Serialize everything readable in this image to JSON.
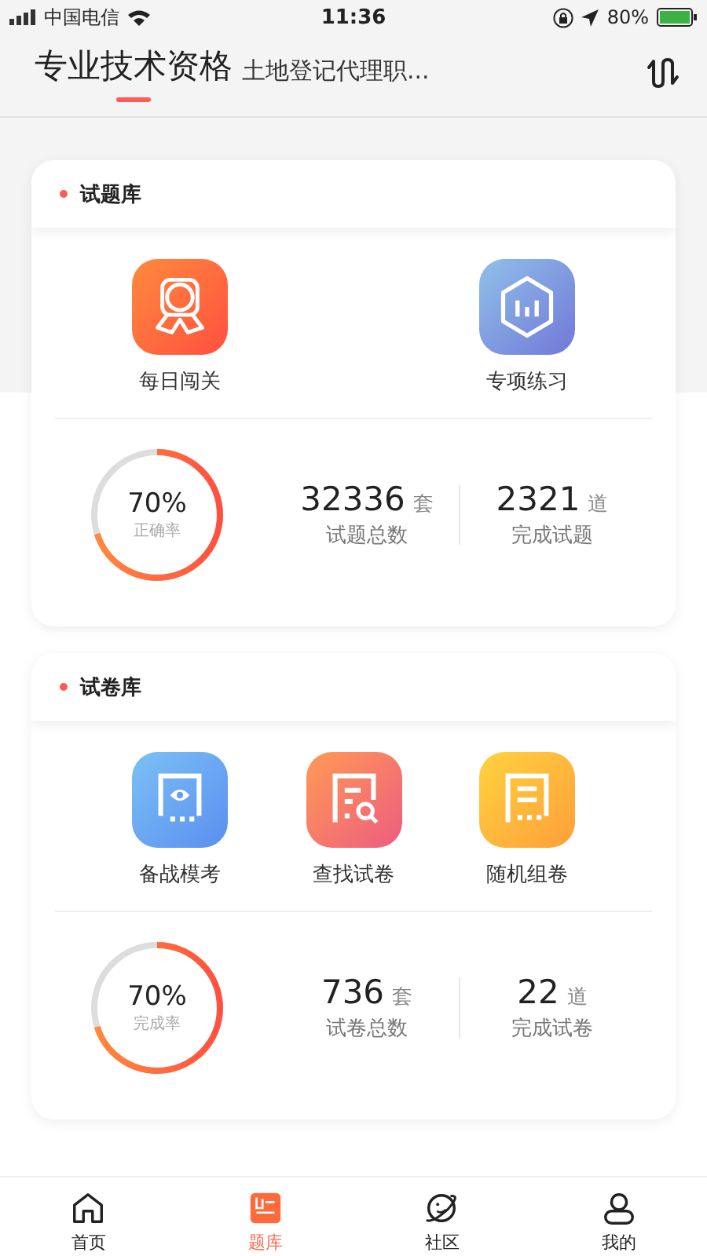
{
  "status_bar": {
    "carrier": "中国电信",
    "time": "11:36",
    "battery": "80%"
  },
  "header": {
    "tabs": [
      {
        "label": "专业技术资格",
        "selected": true
      },
      {
        "label": "土地登记代理职...",
        "selected": false
      }
    ]
  },
  "sections": [
    {
      "title": "试题库",
      "features": [
        {
          "label": "每日闯关",
          "kind": "medal"
        },
        {
          "label": "专项练习",
          "kind": "hexchart"
        }
      ],
      "ring": {
        "level": 0.7,
        "value": "70%",
        "caption": "正确率"
      },
      "stats": [
        {
          "number": "32336",
          "unit": "套",
          "label": "试题总数"
        },
        {
          "number": "2321",
          "unit": "道",
          "label": "完成试题"
        }
      ]
    },
    {
      "title": "试卷库",
      "features": [
        {
          "label": "备战模考",
          "kind": "doc-eye"
        },
        {
          "label": "查找试卷",
          "kind": "doc-search"
        },
        {
          "label": "随机组卷",
          "kind": "doc-list"
        }
      ],
      "ring": {
        "level": 0.7,
        "value": "70%",
        "caption": "完成率"
      },
      "stats": [
        {
          "number": "736",
          "unit": "套",
          "label": "试卷总数"
        },
        {
          "number": "22",
          "unit": "道",
          "label": "完成试卷"
        }
      ]
    }
  ],
  "tab_bar": [
    {
      "label": "首页",
      "kind": "home",
      "selected": false
    },
    {
      "label": "题库",
      "kind": "list",
      "selected": true
    },
    {
      "label": "社区",
      "kind": "planet",
      "selected": false
    },
    {
      "label": "我的",
      "kind": "person",
      "selected": false
    }
  ]
}
